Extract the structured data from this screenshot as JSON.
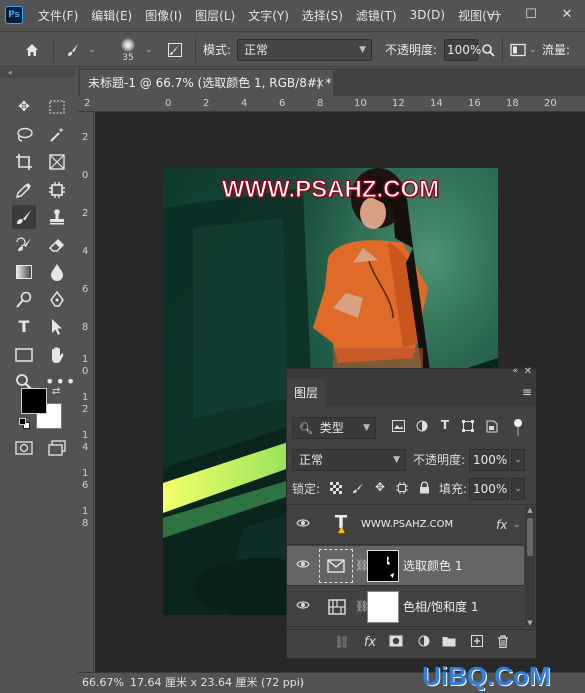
{
  "app": {
    "logo": "Ps"
  },
  "menu": [
    "文件(F)",
    "编辑(E)",
    "图像(I)",
    "图层(L)",
    "文字(Y)",
    "选择(S)",
    "滤镜(T)",
    "3D(D)",
    "视图(V)"
  ],
  "window_controls": {
    "minimize": "—",
    "maximize": "☐",
    "close": "✕"
  },
  "options": {
    "brush_size": "35",
    "mode_label": "模式:",
    "mode_value": "正常",
    "opacity_label": "不透明度:",
    "opacity_value": "100%",
    "flow_label": "流量:"
  },
  "document_tab": {
    "title": "未标题-1 @ 66.7% (选取颜色 1, RGB/8#) *",
    "close": "×"
  },
  "ruler_h": [
    "2",
    "0",
    "2",
    "4",
    "6",
    "8",
    "10",
    "12",
    "14",
    "16",
    "18",
    "20"
  ],
  "ruler_v": [
    "2",
    "0",
    "2",
    "4",
    "6",
    "8",
    "1",
    "0",
    "1",
    "2",
    "1",
    "4",
    "1",
    "6",
    "1",
    "8"
  ],
  "image": {
    "watermark": "WWW.PSAHZ.COM"
  },
  "status": {
    "zoom": "66.67%",
    "info": "17.64 厘米 x 23.64 厘米 (72 ppi)",
    "arrow": "›"
  },
  "layers_panel": {
    "title": "图层",
    "filter_label": "类型",
    "blend_mode": "正常",
    "opacity_label": "不透明度:",
    "opacity_value": "100%",
    "lock_label": "锁定:",
    "fill_label": "填充:",
    "fill_value": "100%",
    "layers": [
      {
        "name": "WWW.PSAHZ.COM",
        "type": "text",
        "fx": "fx"
      },
      {
        "name": "选取颜色  1",
        "type": "adjustment"
      },
      {
        "name": "色相/饱和度  1",
        "type": "adjustment"
      }
    ]
  },
  "site_logo": "UiBQ.CoM",
  "colors": {
    "accent": "#31a8ff",
    "bg": "#535353",
    "panel": "#424242",
    "canvas": "#282828",
    "shirt": "#e06a28"
  }
}
